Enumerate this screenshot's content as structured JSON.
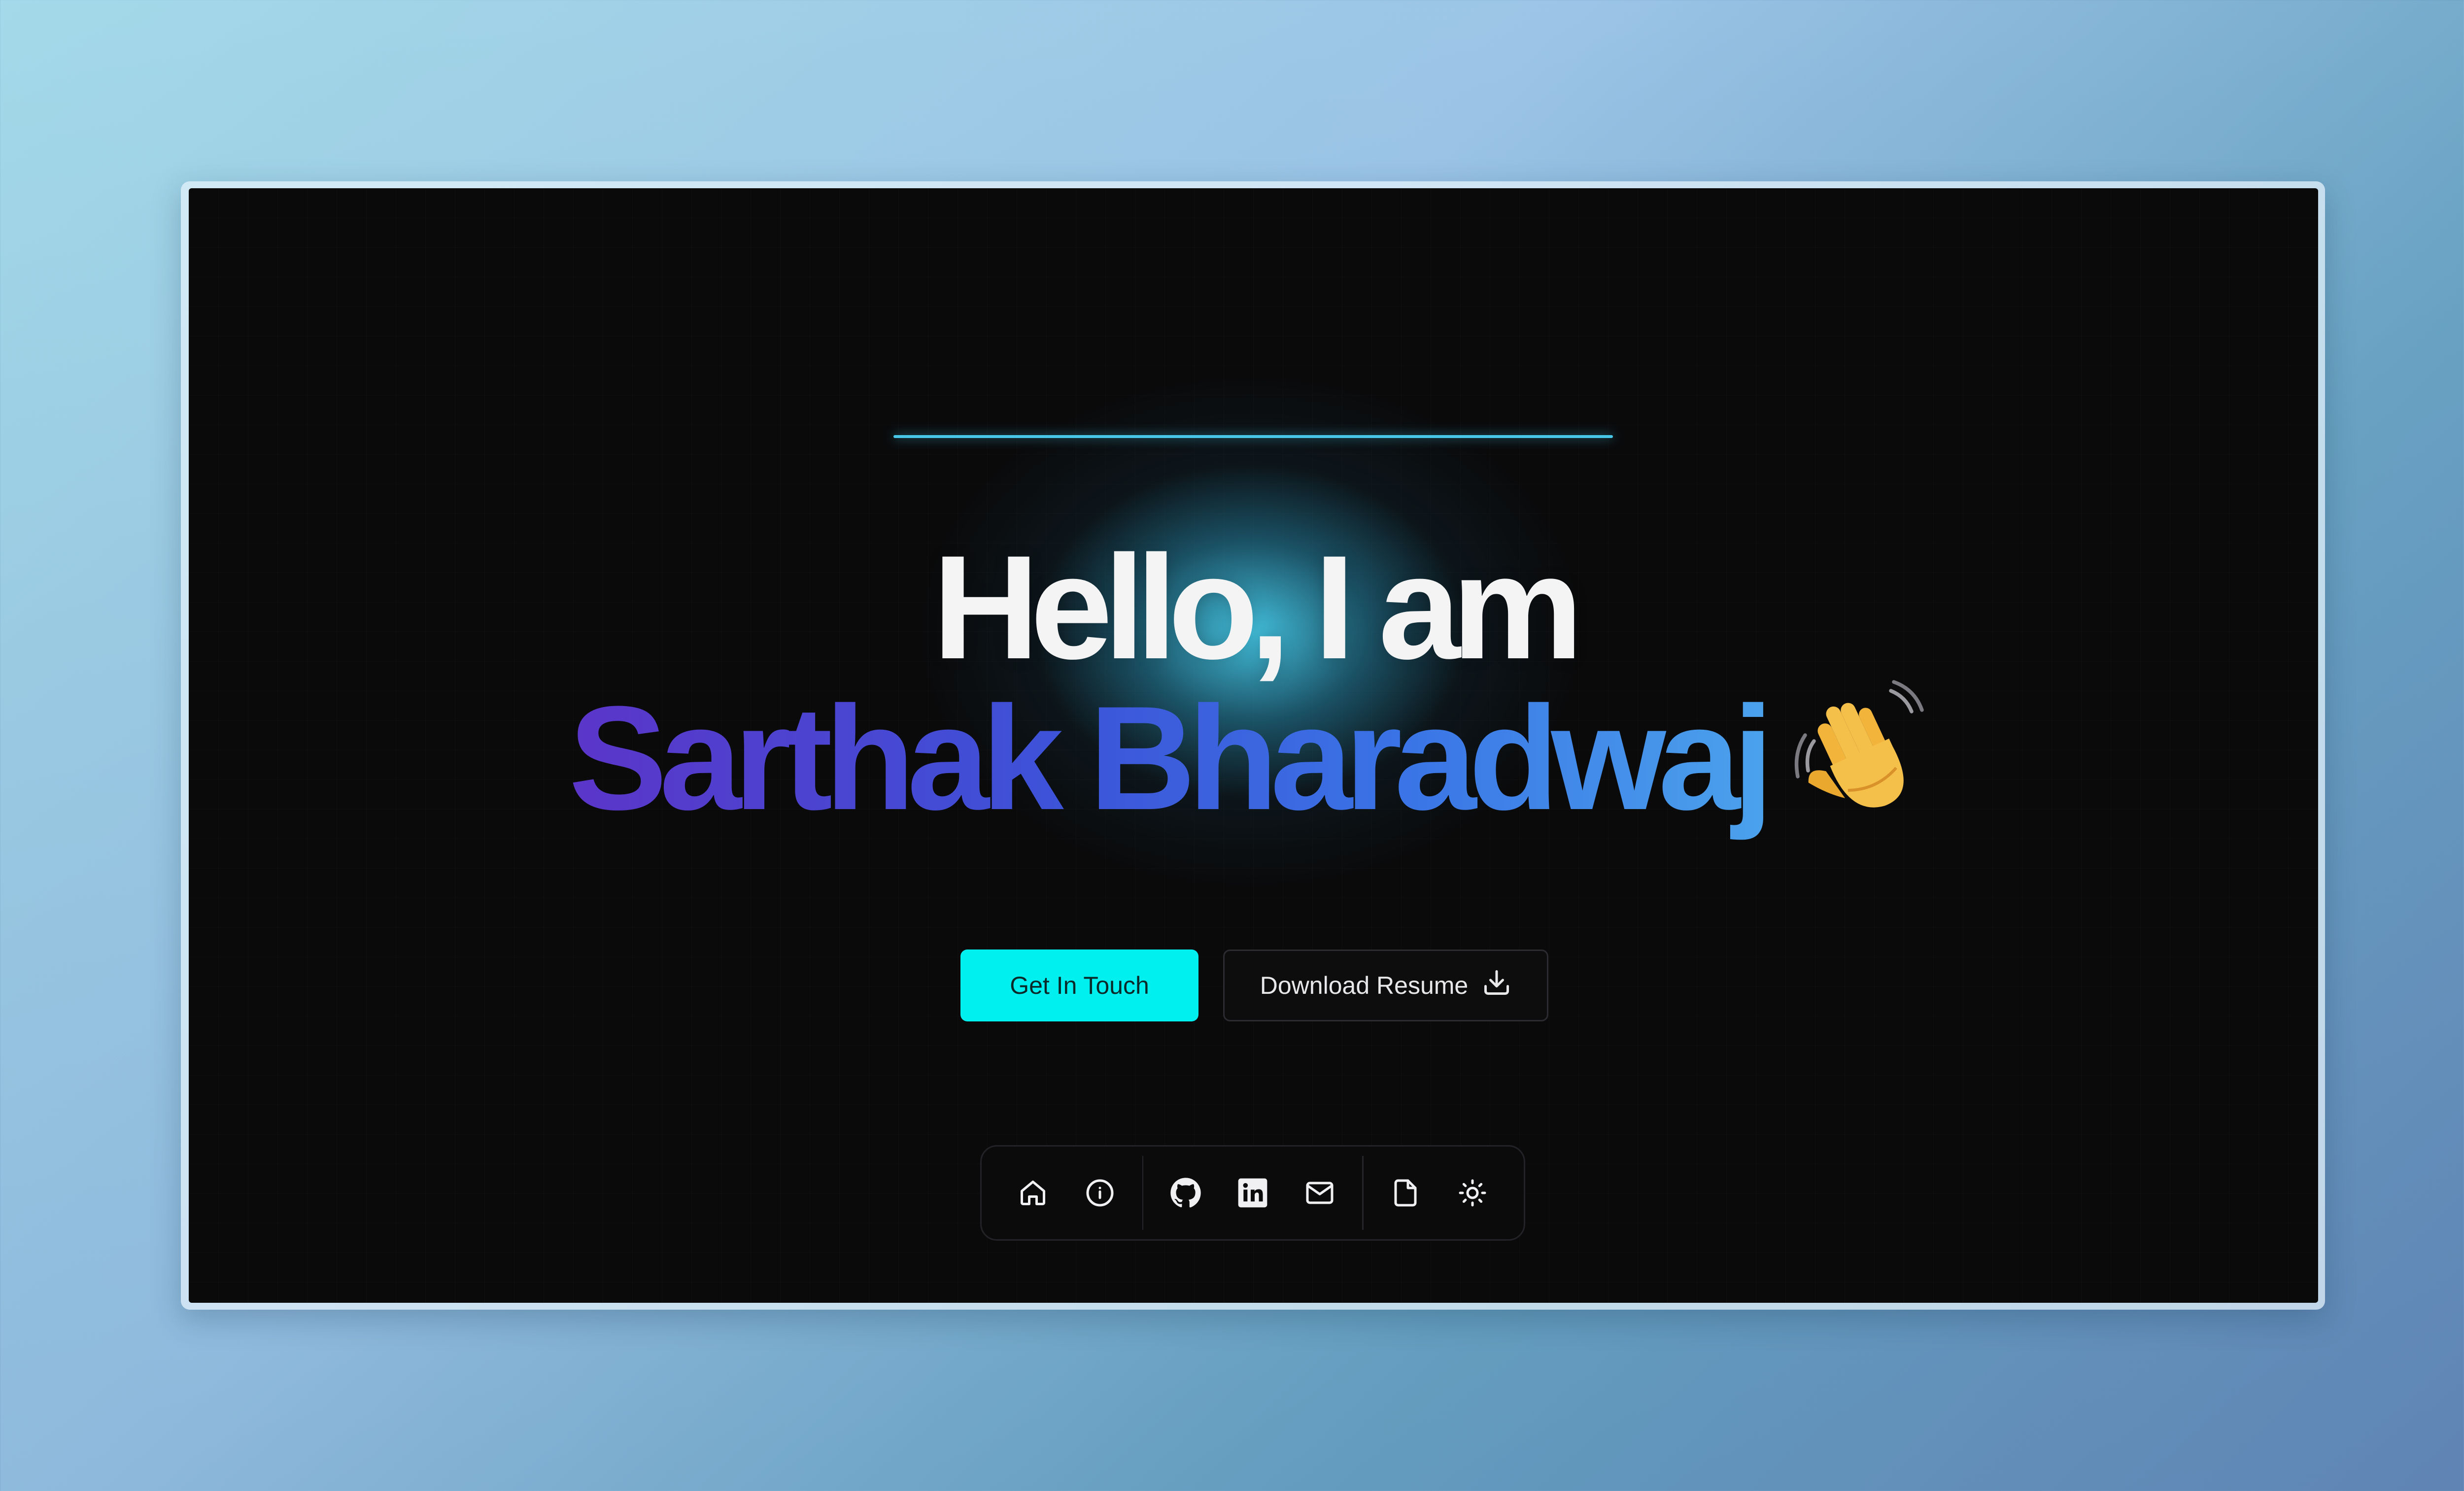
{
  "hero": {
    "greeting": "Hello, I am",
    "name": "Sarthak Bharadwaj",
    "wave_emoji_icon": "waving-hand-icon"
  },
  "buttons": {
    "primary_label": "Get In Touch",
    "secondary_label": "Download Resume",
    "secondary_icon": "download-icon"
  },
  "dock": {
    "items": [
      {
        "icon": "home-icon",
        "label": "Home"
      },
      {
        "icon": "info-icon",
        "label": "About"
      },
      {
        "icon": "github-icon",
        "label": "GitHub"
      },
      {
        "icon": "linkedin-icon",
        "label": "LinkedIn"
      },
      {
        "icon": "mail-icon",
        "label": "Email"
      },
      {
        "icon": "file-icon",
        "label": "Resume"
      },
      {
        "icon": "sun-icon",
        "label": "Theme"
      }
    ]
  },
  "colors": {
    "accent": "#00f0f0",
    "glow": "#48c6e8",
    "name_gradient_start": "#5b35c9",
    "name_gradient_end": "#4ba2ec",
    "background": "#0a0a0b"
  }
}
